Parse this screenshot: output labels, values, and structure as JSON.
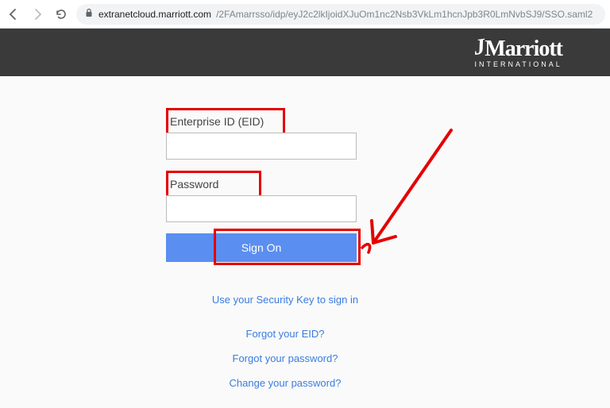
{
  "browser": {
    "url_host": "extranetcloud.marriott.com",
    "url_path": "/2FAmarrsso/idp/eyJ2c2lkIjoidXJuOm1nc2Nsb3VkLm1hcnJpb3R0LmNvbSJ9/SSO.saml2"
  },
  "header": {
    "logo_main": "Marriott",
    "logo_sub": "INTERNATIONAL"
  },
  "form": {
    "eid_label": "Enterprise ID (EID)",
    "eid_value": "",
    "password_label": "Password",
    "password_value": "",
    "signon_label": "Sign On"
  },
  "links": {
    "security_key": "Use your Security Key to sign in",
    "forgot_eid": "Forgot your EID?",
    "forgot_password": "Forgot your password?",
    "change_password": "Change your password?"
  },
  "annotations": {
    "highlight_color": "#e40000",
    "arrow_color": "#e40000"
  }
}
